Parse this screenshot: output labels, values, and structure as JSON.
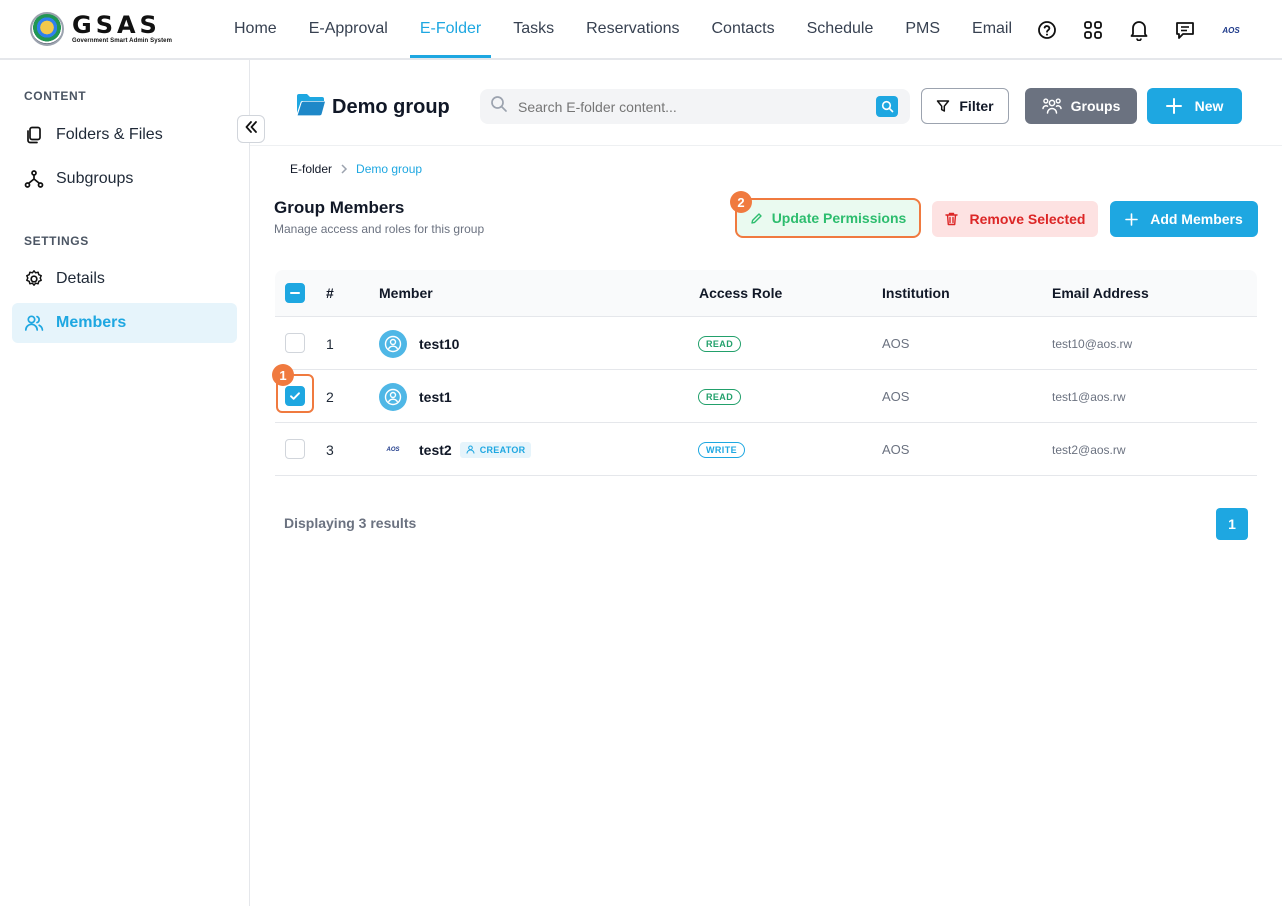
{
  "app": {
    "logo_title": "GSAS",
    "logo_subtitle": "Government Smart Admin System",
    "avatar_text": "AOS"
  },
  "nav": {
    "items": [
      {
        "label": "Home"
      },
      {
        "label": "E-Approval"
      },
      {
        "label": "E-Folder",
        "active": true
      },
      {
        "label": "Tasks"
      },
      {
        "label": "Reservations"
      },
      {
        "label": "Contacts"
      },
      {
        "label": "Schedule"
      },
      {
        "label": "PMS"
      },
      {
        "label": "Email"
      }
    ],
    "icons": [
      "help-icon",
      "apps-grid-icon",
      "bell-icon",
      "chat-icon",
      "user-avatar"
    ]
  },
  "sidebar": {
    "content_heading": "CONTENT",
    "settings_heading": "SETTINGS",
    "items": [
      {
        "label": "Folders & Files",
        "icon": "files-icon"
      },
      {
        "label": "Subgroups",
        "icon": "hierarchy-icon"
      },
      {
        "label": "Details",
        "icon": "gear-icon"
      },
      {
        "label": "Members",
        "icon": "users-icon",
        "active": true
      }
    ]
  },
  "header": {
    "folder_title": "Demo group",
    "search_placeholder": "Search E-folder content...",
    "filter_label": "Filter",
    "groups_label": "Groups",
    "new_label": "New"
  },
  "breadcrumb": {
    "root": "E-folder",
    "current": "Demo group"
  },
  "members_section": {
    "title": "Group Members",
    "subtitle": "Manage access and roles for this group",
    "update_label": "Update Permissions",
    "remove_label": "Remove Selected",
    "add_label": "Add Members"
  },
  "markers": {
    "one": "1",
    "two": "2"
  },
  "table": {
    "columns": {
      "index": "#",
      "member": "Member",
      "role": "Access Role",
      "institution": "Institution",
      "email": "Email Address"
    },
    "rows": [
      {
        "index": "1",
        "member": "test10",
        "role": "READ",
        "institution": "AOS",
        "email": "test10@aos.rw",
        "checked": false
      },
      {
        "index": "2",
        "member": "test1",
        "role": "READ",
        "institution": "AOS",
        "email": "test1@aos.rw",
        "checked": true
      },
      {
        "index": "3",
        "member": "test2",
        "badge": "CREATOR",
        "role": "WRITE",
        "institution": "AOS",
        "email": "test2@aos.rw",
        "checked": false,
        "avatar_text": "AOS"
      }
    ]
  },
  "footer": {
    "results_text": "Displaying 3 results",
    "current_page": "1"
  },
  "colors": {
    "accent": "#1ea7e1",
    "marker": "#f07a3f",
    "read_role": "#22a06b",
    "remove": "#dc2626",
    "update": "#2dbd6e"
  }
}
